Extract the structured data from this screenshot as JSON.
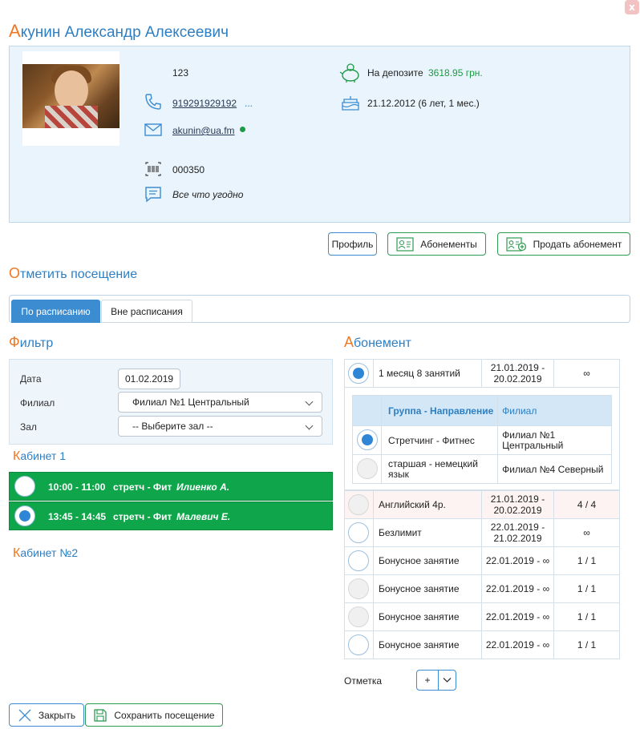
{
  "window": {
    "close_label": "x"
  },
  "client": {
    "name_first_letter": "А",
    "name_rest": "кунин Александр Алексеевич",
    "id": "123",
    "phone": "919291929192",
    "phone_more": "...",
    "email": "akunin@ua.fm",
    "card_number": "000350",
    "note": "Все что угодно",
    "deposit_label": "На депозите",
    "deposit_value": "3618.95 грн.",
    "birthday": "21.12.2012 (6 лет, 1 мес.)"
  },
  "actions": {
    "profile": "Профиль",
    "subscriptions": "Абонементы",
    "sell_subscription": "Продать абонемент"
  },
  "visit": {
    "title_first": "О",
    "title_rest": "тметить посещение",
    "tabs": [
      {
        "label": "По расписанию",
        "active": true
      },
      {
        "label": "Вне расписания",
        "active": false
      }
    ]
  },
  "filter": {
    "title_first": "Ф",
    "title_rest": "ильтр",
    "date_label": "Дата",
    "date_value": "01.02.2019",
    "branch_label": "Филиал",
    "branch_value": "Филиал №1 Центральный",
    "hall_label": "Зал",
    "hall_value": "-- Выберите зал --"
  },
  "rooms": [
    {
      "title_first": "К",
      "title_rest": "абинет 1",
      "sessions": [
        {
          "time": "10:00 - 11:00",
          "group": "стретч - Фит",
          "trainer": "Илиенко А.",
          "selected": false
        },
        {
          "time": "13:45 - 14:45",
          "group": "стретч - Фит",
          "trainer": "Малевич Е.",
          "selected": true
        }
      ]
    },
    {
      "title_first": "К",
      "title_rest": "абинет №2",
      "sessions": []
    }
  ],
  "subscription": {
    "title_first": "А",
    "title_rest": "бонемент",
    "expanded": {
      "name": "1 месяц 8 занятий",
      "dates": "21.01.2019 - 20.02.2019",
      "visits": "∞",
      "header_group": "Группа - Направление",
      "header_branch": "Филиал",
      "groups": [
        {
          "name": "Стретчинг - Фитнес",
          "branch": "Филиал №1 Центральный",
          "selected": true,
          "disabled": false
        },
        {
          "name": "старшая - немецкий язык",
          "branch": "Филиал №4 Северный",
          "selected": false,
          "disabled": true
        }
      ]
    },
    "rows": [
      {
        "name": "Английский 4р.",
        "dates": "21.01.2019 - 20.02.2019",
        "visits": "4 / 4",
        "disabled": true
      },
      {
        "name": "Безлимит",
        "dates": "22.01.2019 - 21.02.2019",
        "visits": "∞",
        "disabled": false
      },
      {
        "name": "Бонусное занятие",
        "dates": "22.01.2019 - ∞",
        "visits": "1 / 1",
        "disabled": false
      },
      {
        "name": "Бонусное занятие",
        "dates": "22.01.2019 - ∞",
        "visits": "1 / 1",
        "disabled": true
      },
      {
        "name": "Бонусное занятие",
        "dates": "22.01.2019 - ∞",
        "visits": "1 / 1",
        "disabled": true
      },
      {
        "name": "Бонусное занятие",
        "dates": "22.01.2019 - ∞",
        "visits": "1 / 1",
        "disabled": false
      }
    ],
    "mark_label": "Отметка",
    "mark_value": "+"
  },
  "footer": {
    "close": "Закрыть",
    "save": "Сохранить посещение"
  },
  "colors": {
    "accent_blue": "#2d7fc3",
    "accent_orange": "#f07822",
    "session_green": "#0fa54a",
    "deposit_green": "#1c9a45"
  }
}
